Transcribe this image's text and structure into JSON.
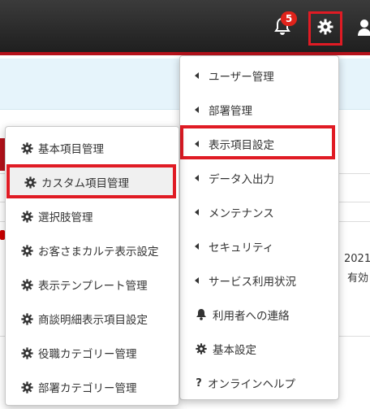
{
  "header": {
    "notification_count": "5",
    "icons": [
      "bell-icon",
      "gear-icon",
      "user-icon"
    ]
  },
  "background": {
    "right_text_1": "2021",
    "right_text_2": "有効"
  },
  "settings_menu": {
    "items": [
      {
        "label": "ユーザー管理",
        "icon": "caret-left-icon"
      },
      {
        "label": "部署管理",
        "icon": "caret-left-icon"
      },
      {
        "label": "表示項目設定",
        "icon": "caret-left-icon",
        "highlighted": true
      },
      {
        "label": "データ入出力",
        "icon": "caret-left-icon"
      },
      {
        "label": "メンテナンス",
        "icon": "caret-left-icon"
      },
      {
        "label": "セキュリティ",
        "icon": "caret-left-icon"
      },
      {
        "label": "サービス利用状況",
        "icon": "caret-left-icon"
      },
      {
        "label": "利用者への連絡",
        "icon": "bell-icon"
      },
      {
        "label": "基本設定",
        "icon": "gear-icon"
      },
      {
        "label": "オンラインヘルプ",
        "icon": "question-icon"
      }
    ]
  },
  "submenu": {
    "items": [
      {
        "label": "基本項目管理"
      },
      {
        "label": "カスタム項目管理",
        "highlighted": true
      },
      {
        "label": "選択肢管理"
      },
      {
        "label": "お客さまカルテ表示設定"
      },
      {
        "label": "表示テンプレート管理"
      },
      {
        "label": "商談明細表示項目設定"
      },
      {
        "label": "役職カテゴリー管理"
      },
      {
        "label": "部署カテゴリー管理"
      }
    ]
  },
  "colors": {
    "topbar": "#2b2b2b",
    "accent_red": "#e01b24",
    "band_blue": "#e6f4fb"
  }
}
